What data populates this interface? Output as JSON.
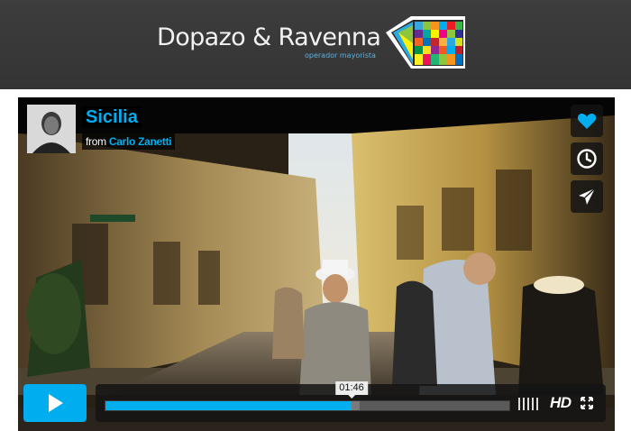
{
  "header": {
    "brand": "Dopazo & Ravenna",
    "tagline": "operador mayorista",
    "logo_icon": "diamond-tile-logo",
    "background": "#383838"
  },
  "video": {
    "title": "Sicilia",
    "byline_prefix": "from",
    "owner": "Carlo Zanetti",
    "avatar_icon": "user-avatar"
  },
  "side_buttons": {
    "like_icon": "heart-icon",
    "watch_later_icon": "clock-icon",
    "share_icon": "paper-plane-icon"
  },
  "controls": {
    "play_icon": "play-icon",
    "current_time": "01:46",
    "progress_fraction": 0.61,
    "loaded_fraction": 0.63,
    "quality_label": "HD",
    "volume_icon": "volume-bars-icon",
    "fullscreen_icon": "fullscreen-icon"
  },
  "colors": {
    "accent": "#00adef",
    "control_bg": "#141414"
  }
}
